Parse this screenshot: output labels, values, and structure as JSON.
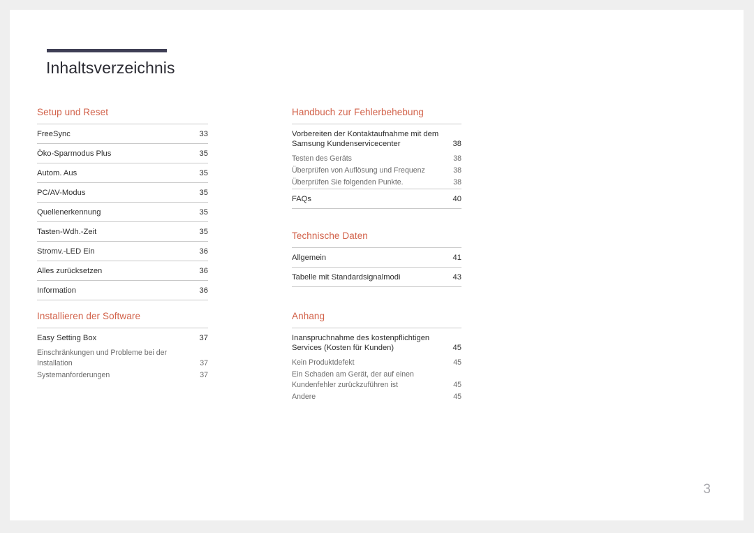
{
  "document": {
    "title": "Inhaltsverzeichnis",
    "page_number": "3",
    "accent_color": "#d2624a",
    "rule_color": "#3f3f55",
    "text_color": "#2f2f2f",
    "subtext_color": "#6d6d6d",
    "folio_color": "#a8a8ad"
  },
  "columns": {
    "left": {
      "sections": [
        {
          "heading": "Setup und Reset",
          "entries": [
            {
              "label": "FreeSync",
              "page": "33",
              "level": 1
            },
            {
              "label": "Öko-Sparmodus Plus",
              "page": "35",
              "level": 1
            },
            {
              "label": "Autom. Aus",
              "page": "35",
              "level": 1
            },
            {
              "label": "PC/AV-Modus",
              "page": "35",
              "level": 1
            },
            {
              "label": "Quellenerkennung",
              "page": "35",
              "level": 1
            },
            {
              "label": "Tasten-Wdh.-Zeit",
              "page": "35",
              "level": 1
            },
            {
              "label": "Stromv.-LED Ein",
              "page": "36",
              "level": 1
            },
            {
              "label": "Alles zurücksetzen",
              "page": "36",
              "level": 1
            },
            {
              "label": "Information",
              "page": "36",
              "level": 1
            }
          ]
        },
        {
          "heading": "Installieren der Software",
          "entries": [
            {
              "label": "Easy Setting Box",
              "page": "37",
              "level": 1
            },
            {
              "label": "Einschränkungen und Probleme bei der Installation",
              "page": "37",
              "level": 2
            },
            {
              "label": "Systemanforderungen",
              "page": "37",
              "level": 2
            }
          ]
        }
      ]
    },
    "right": {
      "sections": [
        {
          "heading": "Handbuch zur Fehlerbehebung",
          "entries": [
            {
              "label": "Vorbereiten der Kontaktaufnahme mit dem Samsung Kundenservicecenter",
              "page": "38",
              "level": 1
            },
            {
              "label": "Testen des Geräts",
              "page": "38",
              "level": 2
            },
            {
              "label": "Überprüfen von Auflösung und Frequenz",
              "page": "38",
              "level": 2
            },
            {
              "label": "Überprüfen Sie folgenden Punkte.",
              "page": "38",
              "level": 2
            },
            {
              "label": "FAQs",
              "page": "40",
              "level": 1
            }
          ]
        },
        {
          "heading": "Technische Daten",
          "entries": [
            {
              "label": "Allgemein",
              "page": "41",
              "level": 1
            },
            {
              "label": "Tabelle mit Standardsignalmodi",
              "page": "43",
              "level": 1
            }
          ]
        },
        {
          "heading": "Anhang",
          "entries": [
            {
              "label": "Inanspruchnahme des kostenpflichtigen Services (Kosten für Kunden)",
              "page": "45",
              "level": 1
            },
            {
              "label": "Kein Produktdefekt",
              "page": "45",
              "level": 2
            },
            {
              "label": "Ein Schaden am Gerät, der auf einen Kundenfehler zurückzuführen ist",
              "page": "45",
              "level": 2
            },
            {
              "label": "Andere",
              "page": "45",
              "level": 2
            }
          ]
        }
      ]
    }
  }
}
